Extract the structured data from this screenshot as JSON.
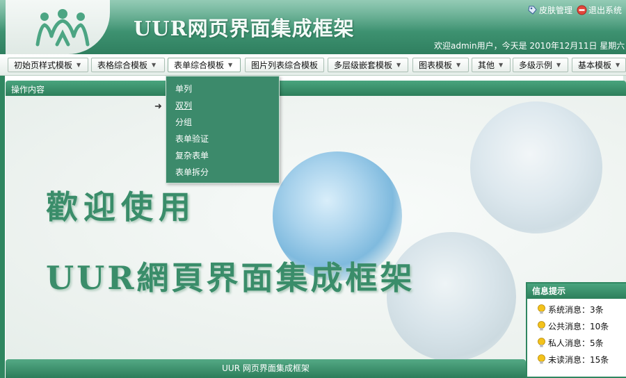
{
  "header": {
    "title": "UUR网页界面集成框架",
    "actions": [
      {
        "label": "皮肤管理",
        "icon": "skin-icon"
      },
      {
        "label": "退出系统",
        "icon": "exit-icon"
      }
    ],
    "welcome": "欢迎admin用户，今天是 2010年12月11日 星期六 "
  },
  "menu": [
    {
      "label": "初始页样式模板"
    },
    {
      "label": "表格综合模板"
    },
    {
      "label": "表单综合模板"
    },
    {
      "label": "图片列表综合模板"
    },
    {
      "label": "多层级嵌套模板"
    },
    {
      "label": "图表模板"
    },
    {
      "label": "其他"
    },
    {
      "label": "多级示例"
    },
    {
      "label": "基本模板"
    }
  ],
  "dropdown": {
    "items": [
      "单列",
      "双列",
      "分组",
      "表单验证",
      "复杂表单",
      "表单拆分"
    ],
    "hovered": "双列"
  },
  "panel": {
    "title": "操作内容"
  },
  "content": {
    "line1": "歡迎使用",
    "line2": "UUR網頁界面集成框架"
  },
  "info": {
    "title": "信息提示",
    "items": [
      {
        "label": "系统消息：3条"
      },
      {
        "label": "公共消息：10条"
      },
      {
        "label": "私人消息：5条"
      },
      {
        "label": "未读消息：15条"
      }
    ]
  },
  "footer": {
    "text": "UUR 网页界面集成框架"
  },
  "colors": {
    "brand_green": "#2f8660",
    "header_green": "#3f9372",
    "dropdown_bg": "#3c8a6b",
    "title_text": "#3a8d6a"
  }
}
